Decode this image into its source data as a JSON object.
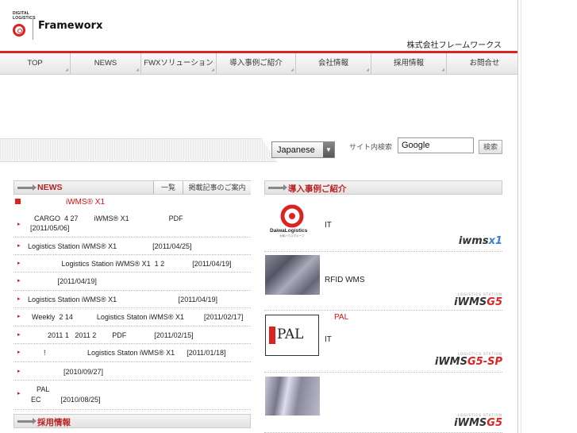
{
  "header": {
    "logo_small": "DIGITAL LOGISTICS",
    "brand": "Frameworx",
    "company": "株式会社フレームワークス"
  },
  "nav": [
    {
      "label": "TOP"
    },
    {
      "label": "NEWS"
    },
    {
      "label": "FWXソリューション"
    },
    {
      "label": "導入事例ご紹介"
    },
    {
      "label": "会社情報"
    },
    {
      "label": "採用情報"
    },
    {
      "label": "お問合せ"
    }
  ],
  "search": {
    "language": "Japanese",
    "label": "サイト内検索",
    "value": "Google",
    "button": "検索"
  },
  "news": {
    "title": "NEWS",
    "tab_list": "一覧",
    "tab_guide": "掲載記事のご案内",
    "headline": "iWMS® X1",
    "items": [
      {
        "line1": "CARGO  4 27        iWMS® X1                    PDF",
        "line2": "[2011/05/06]"
      },
      {
        "line1": "Logistics Station iWMS® X1                  [2011/04/25]"
      },
      {
        "line1": "                 Logistics Station iWMS® X1  1 2              [2011/04/19]"
      },
      {
        "line1": "               [2011/04/19]"
      },
      {
        "line1": "Logistics Station iWMS® X1                               [2011/04/19]"
      },
      {
        "line1": "  Weekly  2 14            Logistics Staton iWMS® X1          [2011/02/17]"
      },
      {
        "line1": "          2011 1   2011 2        PDF              [2011/02/15]"
      },
      {
        "line1": "        !                     Logistics Staton iWMS® X1      [2011/01/18]"
      },
      {
        "line1": "                  [2010/09/27]"
      },
      {
        "line1": "  PAL",
        "line2": "EC          [2010/08/25]"
      }
    ]
  },
  "recruit": {
    "title": "採用情報"
  },
  "cases": {
    "title": "導入事例ご紹介",
    "items": [
      {
        "logo_text": "DaiwaLogistics",
        "logo_sub": "大和ハウスグループ",
        "text1": "IT",
        "text2": "",
        "product": "iwms",
        "product_suffix": "x1",
        "product_top": ""
      },
      {
        "logo_text": "",
        "logo_sub": "",
        "text1": "RFID  WMS",
        "text2": "",
        "product": "iWMS",
        "product_suffix": "G5",
        "product_top": "LOGISTICS STATION"
      },
      {
        "logo_text": "PAL",
        "logo_sub": "",
        "text1": "PAL",
        "text2": "IT",
        "product": "iWMS",
        "product_suffix": "G5-SP",
        "product_top": "LOGISTICS STATION"
      },
      {
        "logo_text": "",
        "logo_sub": "",
        "text1": "",
        "text2": "",
        "product": "iWMS",
        "product_suffix": "G5",
        "product_top": "LOGISTICS STATION"
      }
    ]
  },
  "colors": {
    "accent": "#d22222",
    "text": "#222222"
  }
}
